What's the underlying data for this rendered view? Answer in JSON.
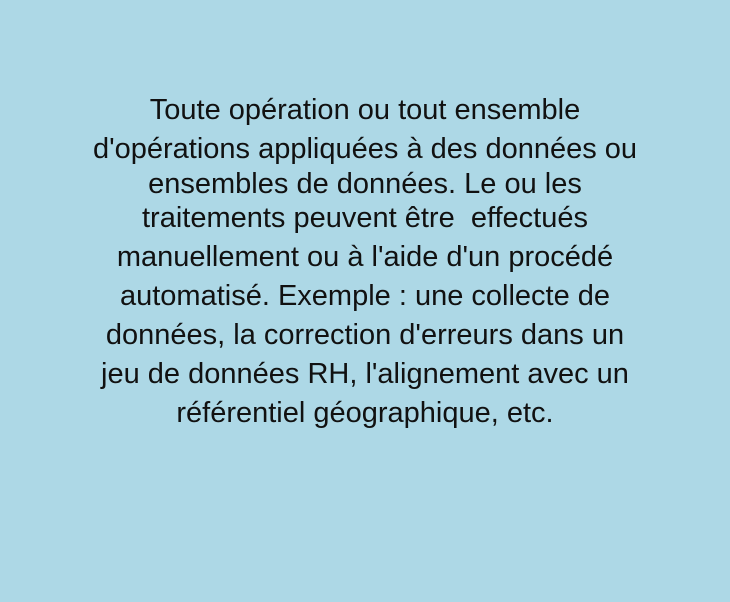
{
  "definition": {
    "paragraph_1": [
      "Toute opération ou tout ensemble",
      "d'opérations appliquées à des données ou",
      "ensembles de données. Le ou les"
    ],
    "paragraph_2": [
      "traitements peuvent être  effectués",
      "manuellement ou à l'aide d'un procédé",
      "automatisé. Exemple : une collecte de",
      "données, la correction d'erreurs dans un",
      "jeu de données RH, l'alignement avec un",
      "référentiel géographique, etc."
    ]
  },
  "colors": {
    "background": "#add8e6",
    "text": "#111111"
  }
}
